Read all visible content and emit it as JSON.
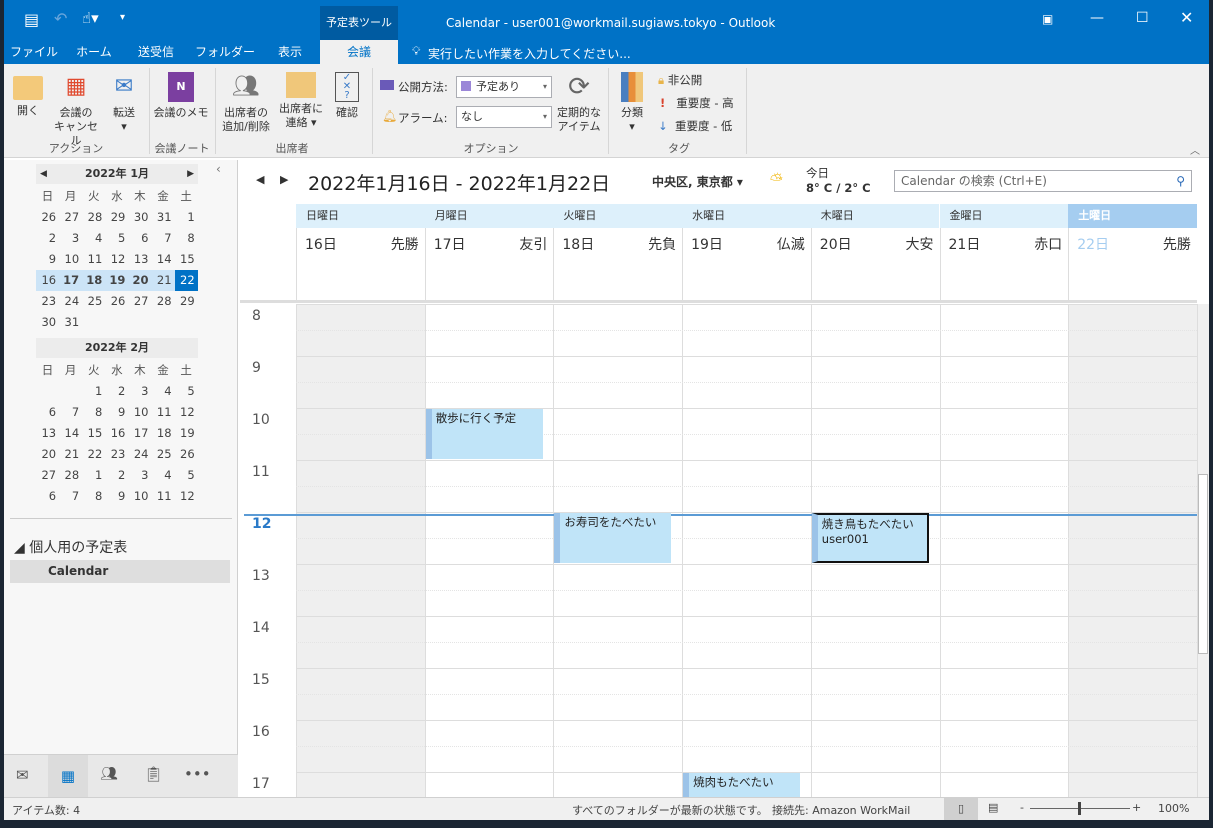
{
  "window": {
    "title": "Calendar - user001@workmail.sugiaws.tokyo - Outlook",
    "context_tab": "予定表ツール"
  },
  "tabs": [
    "ファイル",
    "ホーム",
    "送受信",
    "フォルダー",
    "表示",
    "会議"
  ],
  "tell_me": "実行したい作業を入力してください...",
  "ribbon": {
    "open": "開く",
    "cancel_1": "会議の",
    "cancel_2": "キャンセル",
    "forward": "転送",
    "group_action": "アクション",
    "notes": "会議のメモ",
    "group_notes": "会議ノート",
    "add_rm_1": "出席者の",
    "add_rm_2": "追加/削除",
    "contact_1": "出席者に",
    "contact_2": "連絡",
    "check": "確認",
    "group_attendees": "出席者",
    "show_as_label": "公開方法:",
    "show_as_value": "予定あり",
    "reminder_label": "アラーム:",
    "reminder_value": "なし",
    "recurrence_1": "定期的な",
    "recurrence_2": "アイテム",
    "group_options": "オプション",
    "categorize": "分類",
    "private": "非公開",
    "high": "重要度 - 高",
    "low": "重要度 - 低",
    "group_tags": "タグ"
  },
  "minical": [
    {
      "title": "2022年 1月",
      "weekdays": [
        "日",
        "月",
        "火",
        "水",
        "木",
        "金",
        "土"
      ],
      "days": [
        "26",
        "27",
        "28",
        "29",
        "30",
        "31",
        "1",
        "2",
        "3",
        "4",
        "5",
        "6",
        "7",
        "8",
        "9",
        "10",
        "11",
        "12",
        "13",
        "14",
        "15",
        "16",
        "17",
        "18",
        "19",
        "20",
        "21",
        "22",
        "23",
        "24",
        "25",
        "26",
        "27",
        "28",
        "29",
        "30",
        "31"
      ]
    },
    {
      "title": "2022年 2月",
      "weekdays": [
        "日",
        "月",
        "火",
        "水",
        "木",
        "金",
        "土"
      ],
      "days": [
        "",
        "",
        "1",
        "2",
        "3",
        "4",
        "5",
        "6",
        "7",
        "8",
        "9",
        "10",
        "11",
        "12",
        "13",
        "14",
        "15",
        "16",
        "17",
        "18",
        "19",
        "20",
        "21",
        "22",
        "23",
        "24",
        "25",
        "26",
        "27",
        "28",
        "1",
        "2",
        "3",
        "4",
        "5",
        "6",
        "7",
        "8",
        "9",
        "10",
        "11",
        "12"
      ]
    }
  ],
  "folders": {
    "group": "個人用の予定表",
    "item": "Calendar"
  },
  "calendar": {
    "range": "2022年1月16日 - 2022年1月22日",
    "location": "中央区, 東京都",
    "weather_label": "今日",
    "weather_temp": "8° C / 2° C",
    "search_placeholder": "Calendar の検索 (Ctrl+E)",
    "days": [
      {
        "weekday": "日曜日",
        "date": "16日",
        "rokuyo": "先勝"
      },
      {
        "weekday": "月曜日",
        "date": "17日",
        "rokuyo": "友引"
      },
      {
        "weekday": "火曜日",
        "date": "18日",
        "rokuyo": "先負"
      },
      {
        "weekday": "水曜日",
        "date": "19日",
        "rokuyo": "仏滅"
      },
      {
        "weekday": "木曜日",
        "date": "20日",
        "rokuyo": "大安"
      },
      {
        "weekday": "金曜日",
        "date": "21日",
        "rokuyo": "赤口"
      },
      {
        "weekday": "土曜日",
        "date": "22日",
        "rokuyo": "先勝"
      }
    ],
    "hours": [
      "8",
      "9",
      "10",
      "11",
      "12",
      "13",
      "14",
      "15",
      "16",
      "17"
    ],
    "current_hour": "12",
    "events": [
      {
        "day": 1,
        "start": 10,
        "end": 11,
        "title": "散歩に行く予定",
        "sub": ""
      },
      {
        "day": 2,
        "start": 12,
        "end": 13,
        "title": "お寿司をたべたい",
        "sub": ""
      },
      {
        "day": 4,
        "start": 12,
        "end": 13,
        "title": "焼き鳥もたべたい",
        "sub": "user001",
        "selected": true
      },
      {
        "day": 3,
        "start": 17,
        "end": 18,
        "title": "焼肉もたべたい",
        "sub": ""
      }
    ]
  },
  "status": {
    "items": "アイテム数: 4",
    "sync": "すべてのフォルダーが最新の状態です。",
    "connection": "接続先: Amazon WorkMail",
    "zoom": "100%"
  },
  "colors": {
    "accent": "#0072c6",
    "event": "#c0e4f8"
  }
}
